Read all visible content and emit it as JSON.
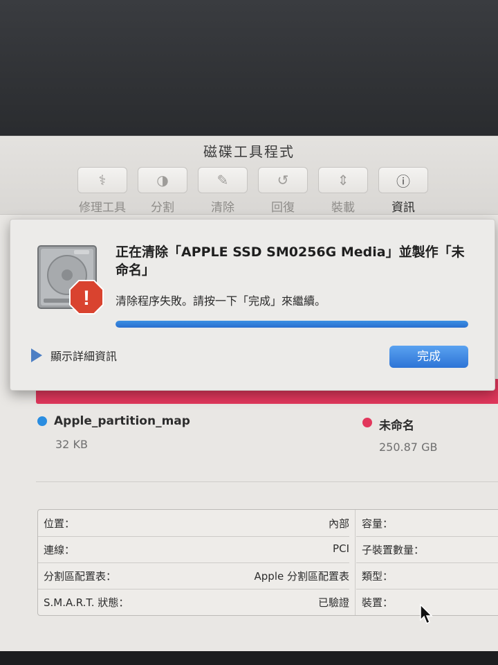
{
  "window": {
    "title": "磁碟工具程式"
  },
  "toolbar": [
    {
      "label": "修理工具",
      "icon": "first-aid-icon",
      "glyph": "⚕"
    },
    {
      "label": "分割",
      "icon": "partition-icon",
      "glyph": "◑"
    },
    {
      "label": "清除",
      "icon": "erase-icon",
      "glyph": "✎"
    },
    {
      "label": "回復",
      "icon": "restore-icon",
      "glyph": "↺"
    },
    {
      "label": "裝載",
      "icon": "mount-icon",
      "glyph": "⇕"
    },
    {
      "label": "資訊",
      "icon": "info-icon",
      "glyph": "ⓘ"
    }
  ],
  "sheet": {
    "title": "正在清除「APPLE SSD SM0256G Media」並製作「未命名」",
    "message": "清除程序失敗。請按一下「完成」來繼續。",
    "progress": 1.0,
    "details_label": "顯示詳細資訊",
    "done_label": "完成",
    "warning_glyph": "!"
  },
  "partitions": [
    {
      "name": "Apple_partition_map",
      "size": "32 KB",
      "color": "#2a8de0"
    },
    {
      "name": "未命名",
      "size": "250.87 GB",
      "color": "#e2375c"
    }
  ],
  "info": {
    "left": [
      {
        "key": "位置：",
        "value": "內部"
      },
      {
        "key": "連線：",
        "value": "PCI"
      },
      {
        "key": "分割區配置表：",
        "value": "Apple 分割區配置表"
      },
      {
        "key": "S.M.A.R.T. 狀態：",
        "value": "已驗證"
      }
    ],
    "right": [
      {
        "key": "容量："
      },
      {
        "key": "子裝置數量："
      },
      {
        "key": "類型："
      },
      {
        "key": "裝置："
      }
    ]
  },
  "colors": {
    "accent": "#2a74d6",
    "usage_bar": "#e2375c",
    "warning": "#d9432f"
  }
}
